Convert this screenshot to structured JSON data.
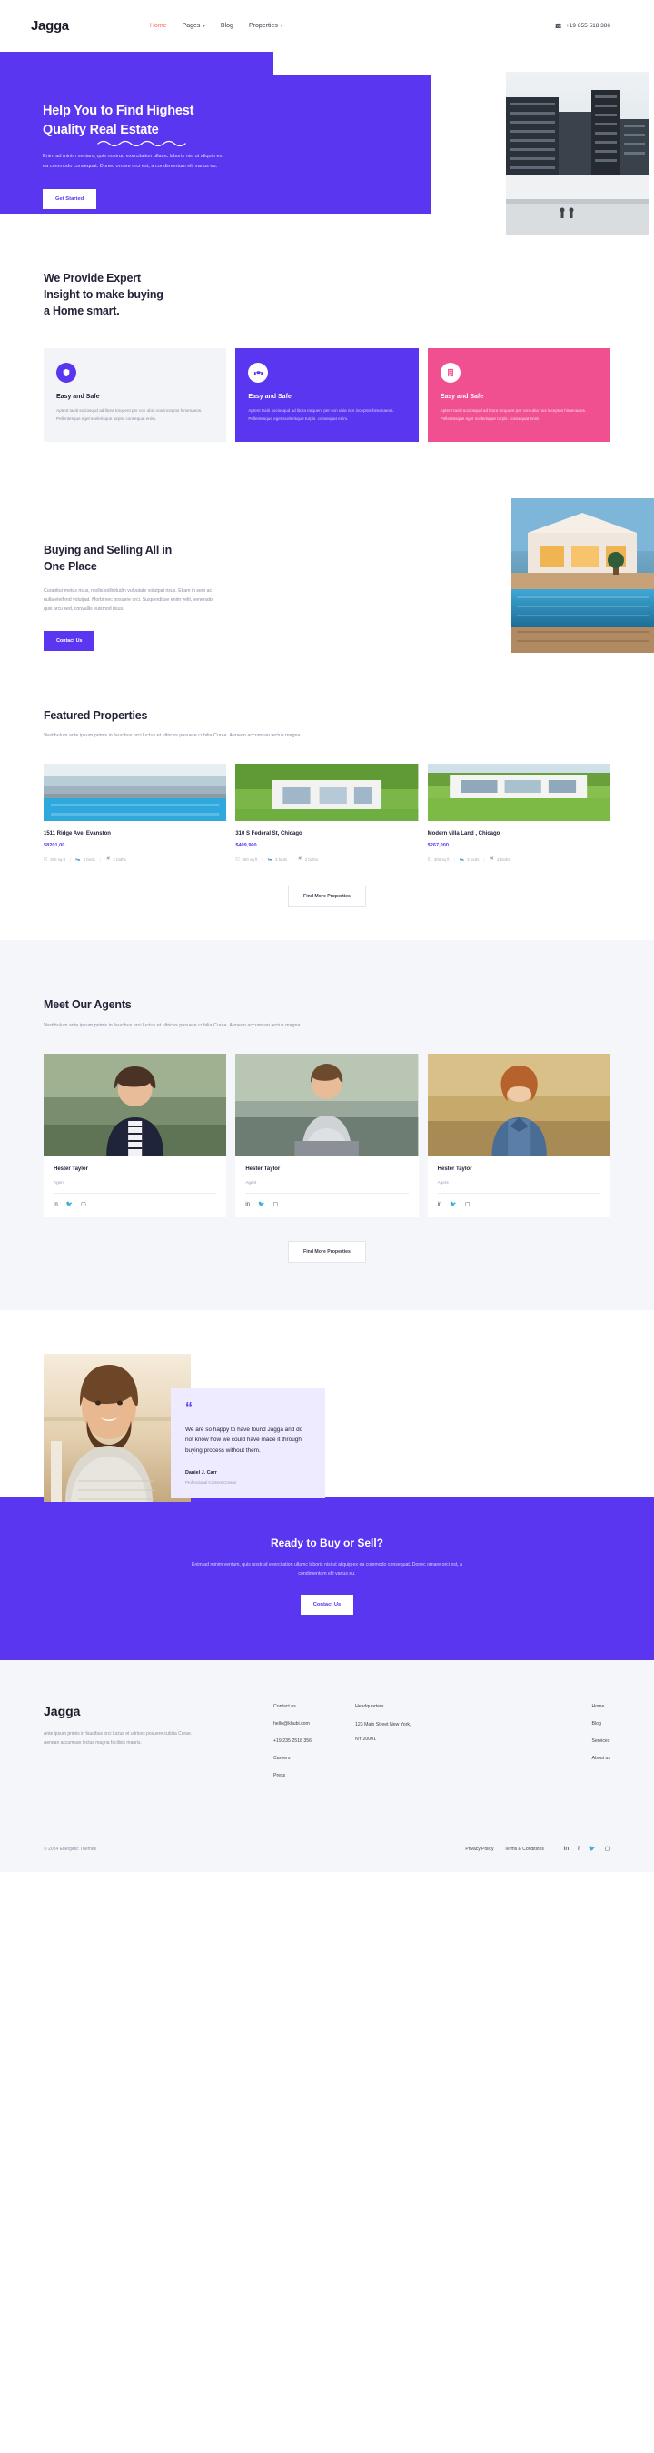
{
  "brand": {
    "name": "Jagga"
  },
  "header": {
    "nav": [
      {
        "label": "Home",
        "active": true,
        "caret": false
      },
      {
        "label": "Pages",
        "active": false,
        "caret": true
      },
      {
        "label": "Blog",
        "active": false,
        "caret": false
      },
      {
        "label": "Properties",
        "active": false,
        "caret": true
      }
    ],
    "phone": "+19 855 518 386",
    "phone_icon": "phone-icon"
  },
  "hero": {
    "title_line1": "Help You to Find Highest",
    "title_line2": "Quality Real Estate",
    "body": "Enim ad minim veniam, quis nostrud exercitation ullamc laboris nisi ut aliquip ex ea commodo consequat. Donec ornare orci est, a condimentum elit varius eu.",
    "cta": "Get Started",
    "image_alt": "modern-office-buildings-photo"
  },
  "expert": {
    "title_line1": "We Provide Expert",
    "title_line2": "Insight to make buying",
    "title_line3": "a Home smart.",
    "cards": [
      {
        "icon": "shield-icon",
        "title": "Easy and Safe",
        "body": "Aptent taciti sociosqud ad litora torquent per con ubia nos inceptos himenaeos. Pellentesque eget scelerisque turpis. consequat enim.",
        "theme": "light",
        "bg": "#f3f4f7"
      },
      {
        "icon": "handshake-icon",
        "title": "Easy and Safe",
        "body": "Aptent taciti sociosqud ad litora torquent per con ubia nos inceptos himenaeos. Pellentesque eget scelerisque turpis. consequat enim.",
        "theme": "purple",
        "bg": "#5a36f0"
      },
      {
        "icon": "building-icon",
        "title": "Easy and Safe",
        "body": "Aptent taciti sociosqud ad litora torquent per con ubia nos inceptos himenaeos. Pellentesque eget scelerisque turpis. consequat enim.",
        "theme": "pink",
        "bg": "#f0508f"
      }
    ]
  },
  "buying": {
    "title_line1": "Buying and Selling All in",
    "title_line2": "One Place",
    "body": "Curabitur metus risus, mollis sollicitudin vulputate volutpat risus. Etiam in sem ac nulla eleifend volutpat. Morbi nec posuere orci. Suspendisse enim velit, venenatis quis arcu sed, convallis euismod risus.",
    "cta": "Contact Us",
    "image_alt": "villa-with-pool-at-dusk-photo"
  },
  "featured": {
    "title": "Featured Properties",
    "subtitle": "Vestibulum ante ipsum primis in faucibus orci luctus et ultrices posuere cubilia Curae. Aenean accumsan lectus magna",
    "more_button": "Find More Properties",
    "properties": [
      {
        "title": "1511 Ridge Ave, Evanston",
        "price": "$8201,00",
        "sqft": "300 sq ft",
        "beds": "3 beds",
        "baths": "2 baths",
        "image_alt": "poolside-modern-house-photo"
      },
      {
        "title": "310 S Federal St, Chicago",
        "price": "$409,900",
        "sqft": "300 sq ft",
        "beds": "3 beds",
        "baths": "2 baths",
        "image_alt": "white-modern-house-with-trees-photo"
      },
      {
        "title": "Modern villa Land , Chicago",
        "price": "$267,000",
        "sqft": "300 sq ft",
        "beds": "3 beds",
        "baths": "2 baths",
        "image_alt": "modern-villa-with-lawn-photo"
      }
    ],
    "meta_icons": {
      "sqft": "ruler-icon",
      "beds": "bed-icon",
      "baths": "bath-icon"
    }
  },
  "agents": {
    "title": "Meet Our Agents",
    "subtitle": "Vestibulum ante ipsum primis in faucibus orci luctus et ultrices posuere cubilia Curae. Aenean accumsan lectus magna",
    "more_button": "Find More Properties",
    "social_icons": [
      "linkedin-icon",
      "twitter-icon",
      "instagram-icon"
    ],
    "list": [
      {
        "name": "Hester Taylor",
        "role": "Agent",
        "image_alt": "woman-agent-in-navy-blazer-photo"
      },
      {
        "name": "Hester Taylor",
        "role": "Agent",
        "image_alt": "man-agent-sitting-outdoors-photo"
      },
      {
        "name": "Hester Taylor",
        "role": "Agent",
        "image_alt": "woman-agent-in-denim-jacket-photo"
      }
    ]
  },
  "testimonial": {
    "quote_icon": "quote-icon",
    "text": "We are so happy to have found Jagga and do not know how we could have made it through buying process without them.",
    "name": "Daniel J. Carr",
    "role": "Professional Content Creator",
    "image_alt": "smiling-bearded-man-at-beach-photo"
  },
  "cta": {
    "title": "Ready to Buy or Sell?",
    "body": "Enim ad minim veniam, quis nostrud exercitation ullamc laboris nisi ut aliquip ex ea commodo consequat. Donec ornare orci est, a condimentum elit varius eu.",
    "button": "Contact Us"
  },
  "footer": {
    "logo": "Jagga",
    "description": "Ante ipsum primis in faucibus orci luctus et ultrices posuere cubilia Curae. Aenean accumsan lectus magna facilisis mauris.",
    "contact": {
      "heading": "Contact us",
      "email": "hello@khubi.com",
      "phone": "+19 235 2518 356",
      "careers": "Careers",
      "press": "Press"
    },
    "headquarters": {
      "heading": "Headquarters",
      "address_line1": "123 Main Street New York,",
      "address_line2": "NY 20001"
    },
    "nav": [
      "Home",
      "Blog",
      "Services",
      "About us"
    ],
    "copyright": "© 2024 Energetic Themes",
    "legal": [
      "Privacy Policy",
      "Terms & Conditions"
    ],
    "social_icons": [
      "linkedin-icon",
      "facebook-icon",
      "twitter-icon",
      "instagram-icon"
    ]
  },
  "colors": {
    "primary": "#5a36f0",
    "accent_pink": "#f0508f",
    "accent_coral": "#ff6b5e",
    "light_bg": "#f5f6f9",
    "testimonial_bg": "#eeeaff"
  }
}
